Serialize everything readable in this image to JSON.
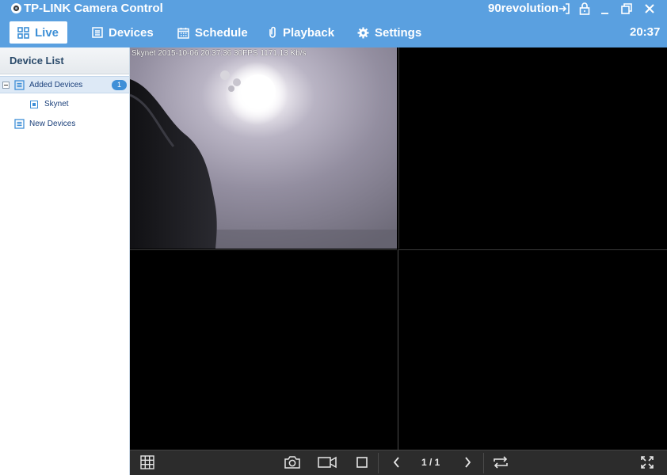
{
  "window": {
    "title": "TP-LINK Camera Control",
    "username": "90revolution"
  },
  "nav": {
    "tabs": [
      {
        "label": "Live",
        "icon": "grid-icon",
        "active": true
      },
      {
        "label": "Devices",
        "icon": "list-icon",
        "active": false
      },
      {
        "label": "Schedule",
        "icon": "calendar-icon",
        "active": false
      },
      {
        "label": "Playback",
        "icon": "paperclip-icon",
        "active": false
      },
      {
        "label": "Settings",
        "icon": "gear-icon",
        "active": false
      }
    ],
    "clock": "20:37"
  },
  "sidebar": {
    "title": "Device List",
    "added_devices": {
      "label": "Added Devices",
      "count": "1"
    },
    "devices": [
      {
        "label": "Skynet"
      }
    ],
    "new_devices": {
      "label": "New Devices"
    }
  },
  "video": {
    "cell1_osd": "Skynet 2015-10-06 20:37:36  30FPS 1171.13 Kb/s"
  },
  "toolbar": {
    "page_indicator": "1 / 1"
  },
  "colors": {
    "accent": "#5aa0e0",
    "toolbar_bg": "#2c2c2c",
    "video_bg": "#000000"
  }
}
